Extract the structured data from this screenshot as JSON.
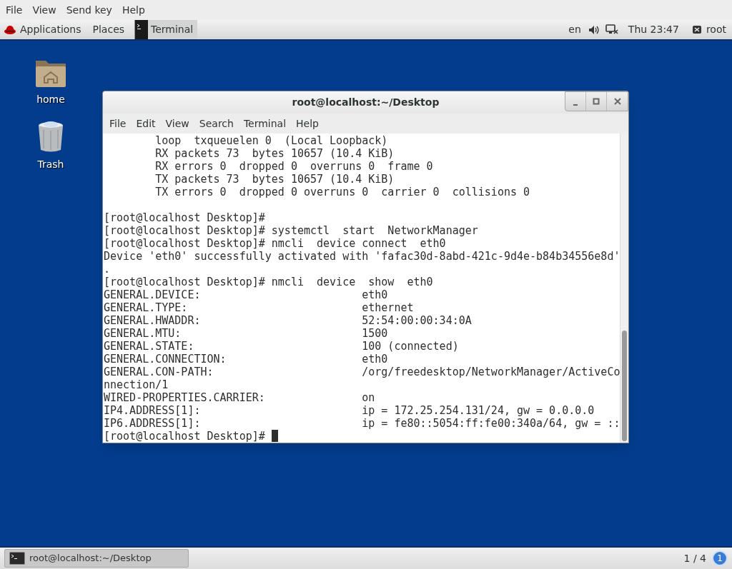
{
  "menu_bar": {
    "items": [
      "File",
      "View",
      "Send key",
      "Help"
    ]
  },
  "top_panel": {
    "applications": "Applications",
    "places": "Places",
    "task": "Terminal",
    "language": "en",
    "clock": "Thu 23:47",
    "user": "root"
  },
  "desktop_icons": [
    {
      "kind": "home",
      "label": "home"
    },
    {
      "kind": "trash",
      "label": "Trash"
    }
  ],
  "terminal": {
    "title": "root@localhost:~/Desktop",
    "menu": [
      "File",
      "Edit",
      "View",
      "Search",
      "Terminal",
      "Help"
    ],
    "lines": [
      {
        "kind": "text",
        "text": "        loop  txqueuelen 0  (Local Loopback)"
      },
      {
        "kind": "text",
        "text": "        RX packets 73  bytes 10657 (10.4 KiB)"
      },
      {
        "kind": "text",
        "text": "        RX errors 0  dropped 0  overruns 0  frame 0"
      },
      {
        "kind": "text",
        "text": "        TX packets 73  bytes 10657 (10.4 KiB)"
      },
      {
        "kind": "text",
        "text": "        TX errors 0  dropped 0 overruns 0  carrier 0  collisions 0"
      },
      {
        "kind": "blank"
      },
      {
        "kind": "text",
        "text": "[root@localhost Desktop]#"
      },
      {
        "kind": "text",
        "text": "[root@localhost Desktop]# systemctl  start  NetworkManager"
      },
      {
        "kind": "text",
        "text": "[root@localhost Desktop]# nmcli  device connect  eth0"
      },
      {
        "kind": "text",
        "text": "Device 'eth0' successfully activated with 'fafac30d-8abd-421c-9d4e-b84b34556e8d'"
      },
      {
        "kind": "text",
        "text": "."
      },
      {
        "kind": "text",
        "text": "[root@localhost Desktop]# nmcli  device  show  eth0"
      },
      {
        "kind": "text",
        "text": "GENERAL.DEVICE:                         eth0"
      },
      {
        "kind": "text",
        "text": "GENERAL.TYPE:                           ethernet"
      },
      {
        "kind": "text",
        "text": "GENERAL.HWADDR:                         52:54:00:00:34:0A"
      },
      {
        "kind": "text",
        "text": "GENERAL.MTU:                            1500"
      },
      {
        "kind": "text",
        "text": "GENERAL.STATE:                          100 (connected)"
      },
      {
        "kind": "text",
        "text": "GENERAL.CONNECTION:                     eth0"
      },
      {
        "kind": "text",
        "text": "GENERAL.CON-PATH:                       /org/freedesktop/NetworkManager/ActiveCo"
      },
      {
        "kind": "text",
        "text": "nnection/1"
      },
      {
        "kind": "text",
        "text": "WIRED-PROPERTIES.CARRIER:               on"
      },
      {
        "kind": "text",
        "text": "IP4.ADDRESS[1]:                         ip = 172.25.254.131/24, gw = 0.0.0.0"
      },
      {
        "kind": "text",
        "text": "IP6.ADDRESS[1]:                         ip = fe80::5054:ff:fe00:340a/64, gw = ::"
      },
      {
        "kind": "prompt",
        "text": "[root@localhost Desktop]# "
      }
    ]
  },
  "bottom_panel": {
    "task": "root@localhost:~/Desktop",
    "workspace": "1 / 4",
    "notifications": "1"
  }
}
